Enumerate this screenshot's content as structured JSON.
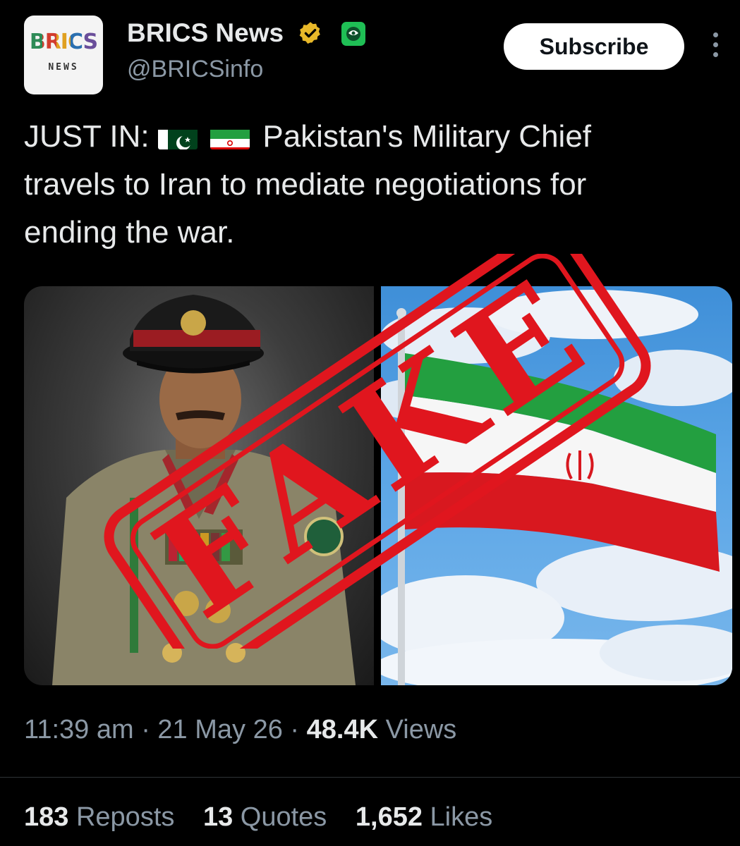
{
  "header": {
    "avatar_text": "BRICS",
    "avatar_subtext": "NEWS",
    "account_name": "BRICS News",
    "account_handle": "@BRICSinfo",
    "subscribe_label": "Subscribe"
  },
  "tweet": {
    "prefix": "JUST IN:",
    "line1_rest": "Pakistan's Military Chief",
    "line2": "travels to Iran to mediate negotiations for",
    "line3": "ending the war.",
    "flags": [
      "pakistan-flag",
      "iran-flag"
    ]
  },
  "media": {
    "left_image": "portrait of military officer in cap and uniform",
    "right_image": "Iran flag waving against blue sky",
    "stamp_text": "FAKE",
    "stamp_color": "#e0161e"
  },
  "meta": {
    "time": "11:39 am",
    "date": "21 May 26",
    "views_count": "48.4K",
    "views_label": "Views",
    "separator": "·"
  },
  "stats": {
    "reposts_count": "183",
    "reposts_label": "Reposts",
    "quotes_count": "13",
    "quotes_label": "Quotes",
    "likes_count": "1,652",
    "likes_label": "Likes"
  },
  "colors": {
    "background": "#000000",
    "text_primary": "#e7e9ea",
    "text_secondary": "#8b98a5",
    "verified_gold": "#e8b829",
    "affiliate_green": "#1fbf55"
  }
}
